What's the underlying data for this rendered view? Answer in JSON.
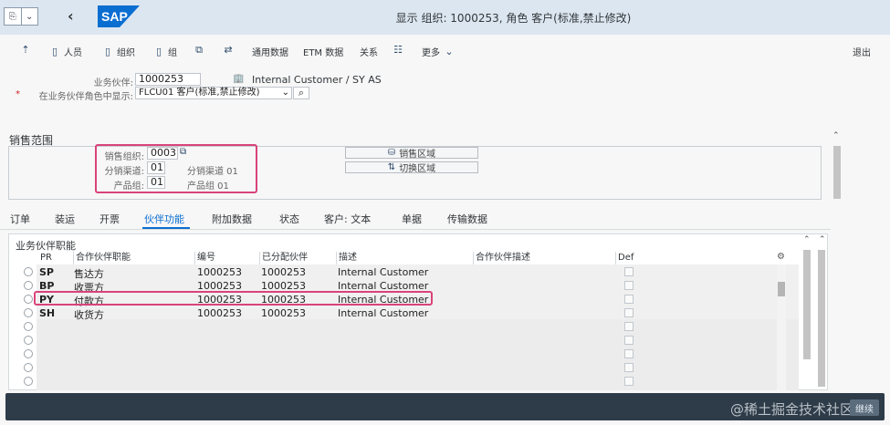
{
  "shell": {
    "title": "显示 组织: 1000253, 角色 客户(标准,禁止修改)",
    "back_icon": "chevron-left-icon"
  },
  "toolbar": {
    "items": [
      {
        "label": "",
        "icon": "display-icon"
      },
      {
        "label": "人员",
        "icon": "document-icon"
      },
      {
        "label": "组织",
        "icon": "document-icon"
      },
      {
        "label": "组",
        "icon": "document-icon"
      },
      {
        "label": "",
        "icon": "copy-icon"
      },
      {
        "label": "",
        "icon": "swap-icon"
      },
      {
        "label": "通用数据",
        "icon": ""
      },
      {
        "label": "ETM 数据",
        "icon": ""
      },
      {
        "label": "关系",
        "icon": ""
      },
      {
        "label": "",
        "icon": "list-icon"
      },
      {
        "label": "更多",
        "icon": "chevron-down-icon"
      }
    ],
    "exit_label": "退出"
  },
  "header": {
    "bp_label": "业务伙伴:",
    "bp_value": "1000253",
    "bp_desc": "Internal Customer / SY AS",
    "role_label": "在业务伙伴角色中显示:",
    "role_value": "FLCU01 客户(标准,禁止修改)",
    "required_mark": "*"
  },
  "sales_area": {
    "title": "销售范围",
    "org_label": "销售组织:",
    "org_value": "0003",
    "channel_label": "分销渠道:",
    "channel_value": "01",
    "channel_desc": "分销渠道 01",
    "division_label": "产品组:",
    "division_value": "01",
    "division_desc": "产品组 01",
    "btn_sales_area": "销售区域",
    "btn_switch_area": "切换区域"
  },
  "tabs": [
    "订单",
    "装运",
    "开票",
    "伙伴功能",
    "附加数据",
    "状态",
    "客户: 文本",
    "单据",
    "传输数据"
  ],
  "active_tab": "伙伴功能",
  "partner_table": {
    "title": "业务伙伴职能",
    "columns": [
      "PR",
      "合作伙伴职能",
      "编号",
      "已分配伙伴",
      "描述",
      "合作伙伴描述",
      "Def"
    ],
    "rows": [
      {
        "pr": "SP",
        "func": "售达方",
        "num": "1000253",
        "partner": "1000253",
        "desc": "Internal Customer"
      },
      {
        "pr": "BP",
        "func": "收票方",
        "num": "1000253",
        "partner": "1000253",
        "desc": "Internal Customer"
      },
      {
        "pr": "PY",
        "func": "付款方",
        "num": "1000253",
        "partner": "1000253",
        "desc": "Internal Customer"
      },
      {
        "pr": "SH",
        "func": "收货方",
        "num": "1000253",
        "partner": "1000253",
        "desc": "Internal Customer"
      }
    ]
  },
  "status": {
    "watermark": "@稀土掘金技术社区",
    "ok_label": "继续"
  },
  "colors": {
    "shell_bg": "#dce6f0",
    "accent": "#0a6ed1",
    "highlight": "#d9437a",
    "statusbar": "#2e3c49"
  }
}
